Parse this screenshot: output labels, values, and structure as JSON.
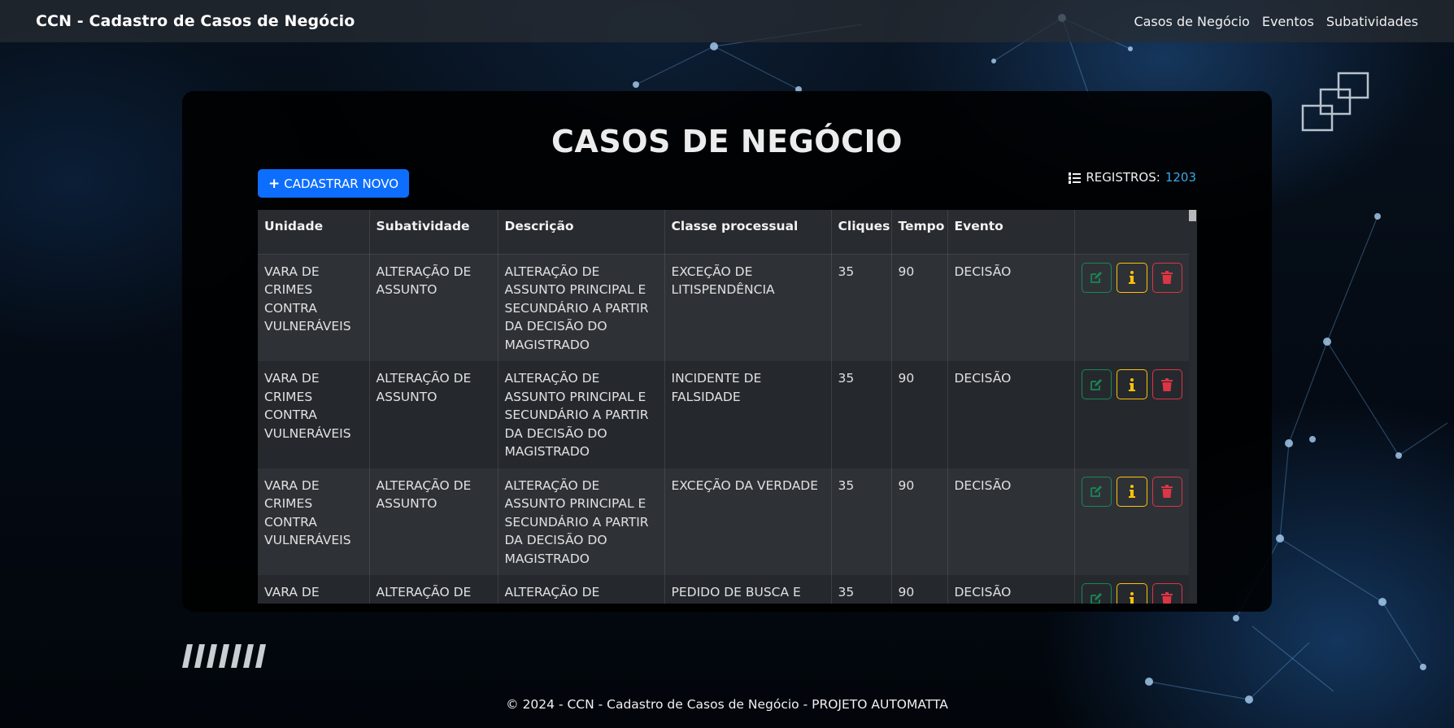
{
  "navbar": {
    "brand": "CCN - Cadastro de Casos de Negócio",
    "links": [
      "Casos de Negócio",
      "Eventos",
      "Subatividades"
    ]
  },
  "page": {
    "title": "CASOS DE NEGÓCIO",
    "new_button_label": "CADASTRAR NOVO",
    "records_label": "REGISTROS:",
    "records_count": "1203"
  },
  "table": {
    "headers": [
      "Unidade",
      "Subatividade",
      "Descrição",
      "Classe processual",
      "Cliques",
      "Tempo",
      "Evento",
      ""
    ],
    "rows": [
      {
        "unidade": "VARA DE CRIMES CONTRA VULNERÁVEIS",
        "subatividade": "ALTERAÇÃO DE ASSUNTO",
        "descricao": "ALTERAÇÃO DE ASSUNTO PRINCIPAL E SECUNDÁRIO A PARTIR DA DECISÃO DO MAGISTRADO",
        "classe": "EXCEÇÃO DE LITISPENDÊNCIA",
        "cliques": "35",
        "tempo": "90",
        "evento": "DECISÃO"
      },
      {
        "unidade": "VARA DE CRIMES CONTRA VULNERÁVEIS",
        "subatividade": "ALTERAÇÃO DE ASSUNTO",
        "descricao": "ALTERAÇÃO DE ASSUNTO PRINCIPAL E SECUNDÁRIO A PARTIR DA DECISÃO DO MAGISTRADO",
        "classe": "INCIDENTE DE FALSIDADE",
        "cliques": "35",
        "tempo": "90",
        "evento": "DECISÃO"
      },
      {
        "unidade": "VARA DE CRIMES CONTRA VULNERÁVEIS",
        "subatividade": "ALTERAÇÃO DE ASSUNTO",
        "descricao": "ALTERAÇÃO DE ASSUNTO PRINCIPAL E SECUNDÁRIO A PARTIR DA DECISÃO DO MAGISTRADO",
        "classe": "EXCEÇÃO DA VERDADE",
        "cliques": "35",
        "tempo": "90",
        "evento": "DECISÃO"
      },
      {
        "unidade": "VARA DE CRIMES CONTRA VULNERÁVEIS",
        "subatividade": "ALTERAÇÃO DE ASSUNTO",
        "descricao": "ALTERAÇÃO DE ASSUNTO PRINCIPAL E SECUNDÁRIO A PARTIR DA DECISÃO DO MAGISTRADO",
        "classe": "PEDIDO DE BUSCA E APREENSÃO CRIMINAL",
        "cliques": "35",
        "tempo": "90",
        "evento": "DECISÃO"
      }
    ],
    "row_actions": [
      {
        "name": "edit-button",
        "icon": "edit-icon",
        "color": "#198754"
      },
      {
        "name": "info-button",
        "icon": "info-icon",
        "color": "#ffc107"
      },
      {
        "name": "delete-button",
        "icon": "trash-icon",
        "color": "#dc3545"
      }
    ]
  },
  "footer": {
    "text": "© 2024 - CCN - Cadastro de Casos de Negócio - PROJETO AUTOMATTA"
  },
  "colors": {
    "primary": "#0d6efd",
    "success": "#198754",
    "warning": "#ffc107",
    "danger": "#dc3545",
    "records_count": "#3aa8e8"
  }
}
